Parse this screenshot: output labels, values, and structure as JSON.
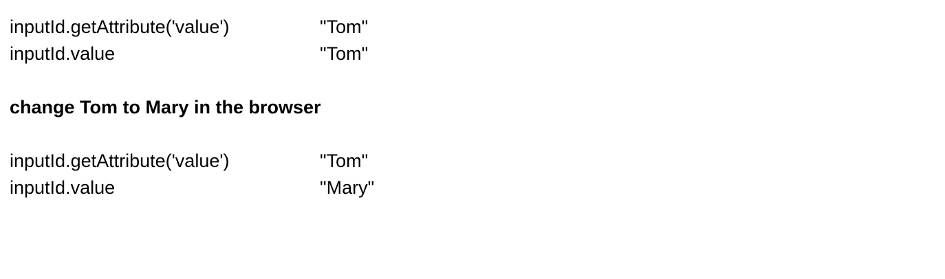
{
  "before": [
    {
      "expression": "inputId.getAttribute('value')",
      "result": "\"Tom\""
    },
    {
      "expression": "inputId.value",
      "result": "\"Tom\""
    }
  ],
  "heading": "change Tom to Mary in the browser",
  "after": [
    {
      "expression": "inputId.getAttribute('value')",
      "result": "\"Tom\""
    },
    {
      "expression": "inputId.value",
      "result": "\"Mary\""
    }
  ]
}
